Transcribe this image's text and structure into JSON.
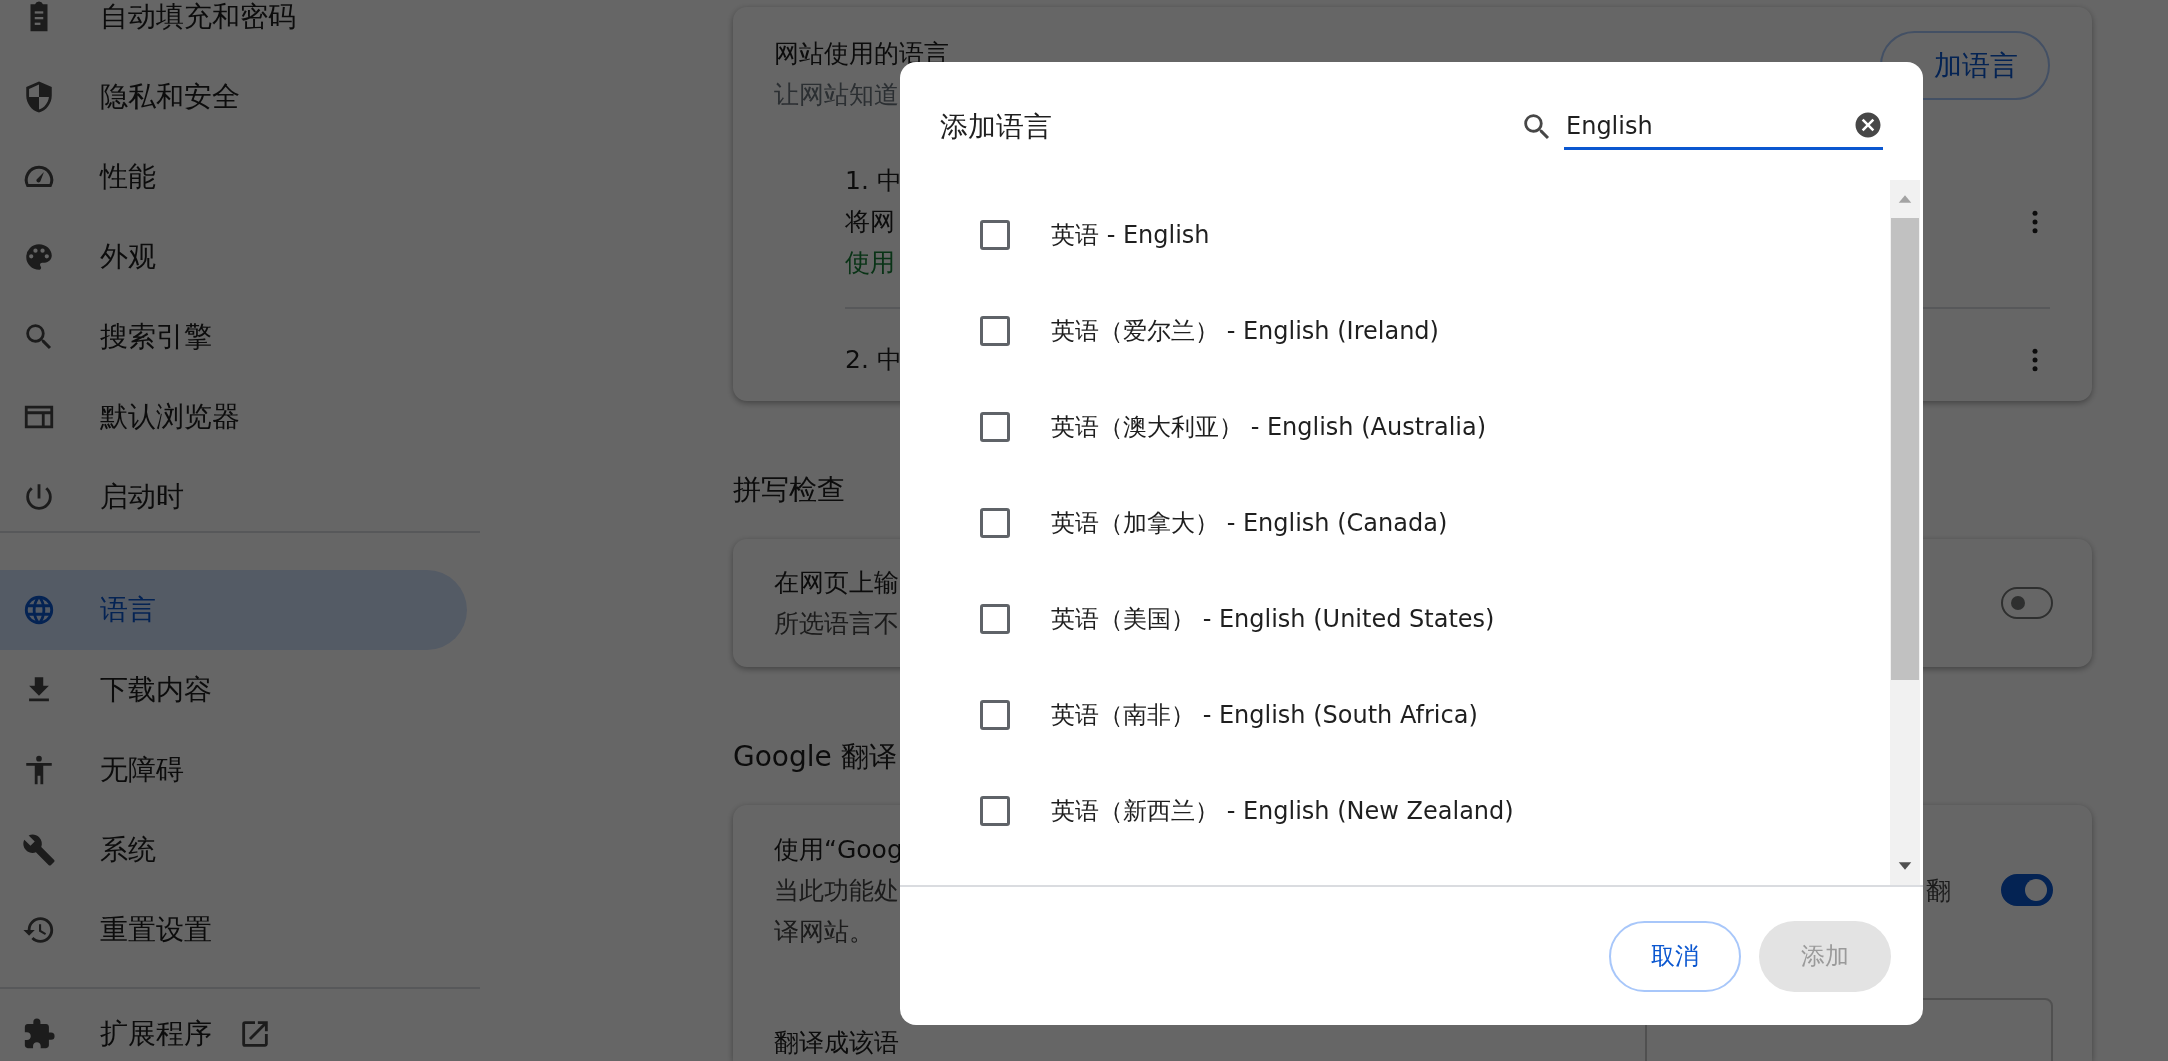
{
  "sidebar": {
    "groups": [
      {
        "items": [
          {
            "label": "自动填充和密码",
            "selected": false
          },
          {
            "label": "隐私和安全",
            "selected": false
          },
          {
            "label": "性能",
            "selected": false
          },
          {
            "label": "外观",
            "selected": false
          },
          {
            "label": "搜索引擎",
            "selected": false
          },
          {
            "label": "默认浏览器",
            "selected": false
          },
          {
            "label": "启动时",
            "selected": false
          }
        ]
      },
      {
        "items": [
          {
            "label": "语言",
            "selected": true
          },
          {
            "label": "下载内容",
            "selected": false
          },
          {
            "label": "无障碍",
            "selected": false
          },
          {
            "label": "系统",
            "selected": false
          },
          {
            "label": "重置设置",
            "selected": false
          }
        ]
      },
      {
        "items": [
          {
            "label": "扩展程序",
            "selected": false,
            "external": true
          }
        ]
      }
    ]
  },
  "languages_card": {
    "title": "网站使用的语言",
    "description": "让网站知道",
    "button": "加语言",
    "items": [
      {
        "lines": [
          {
            "text": "1. 中",
            "kind": "text"
          },
          {
            "text": "将网",
            "kind": "text"
          },
          {
            "text": "使用",
            "kind": "status"
          }
        ]
      },
      {
        "lines": [
          {
            "text": "2. 中",
            "kind": "text"
          }
        ]
      }
    ]
  },
  "spellcheck": {
    "heading": "拼写检查",
    "lines": [
      "在网页上输",
      "所选语言不"
    ],
    "on": false
  },
  "translate": {
    "heading": "Google 翻译",
    "lines": [
      "使用“Goog",
      "当此功能处",
      "译网站。"
    ],
    "side_text": "翻",
    "on": true,
    "target_label": "翻译成该语"
  },
  "dialog": {
    "title": "添加语言",
    "search": {
      "value": "English"
    },
    "options": [
      {
        "label": "英语 - English",
        "checked": false
      },
      {
        "label": "英语（爱尔兰） - English (Ireland)",
        "checked": false
      },
      {
        "label": "英语（澳大利亚） - English (Australia)",
        "checked": false
      },
      {
        "label": "英语（加拿大） - English (Canada)",
        "checked": false
      },
      {
        "label": "英语（美国） - English (United States)",
        "checked": false
      },
      {
        "label": "英语（南非） - English (South Africa)",
        "checked": false
      },
      {
        "label": "英语（新西兰） - English (New Zealand)",
        "checked": false
      }
    ],
    "buttons": [
      {
        "label": "取消",
        "disabled": false
      },
      {
        "label": "添加",
        "disabled": true
      }
    ]
  }
}
